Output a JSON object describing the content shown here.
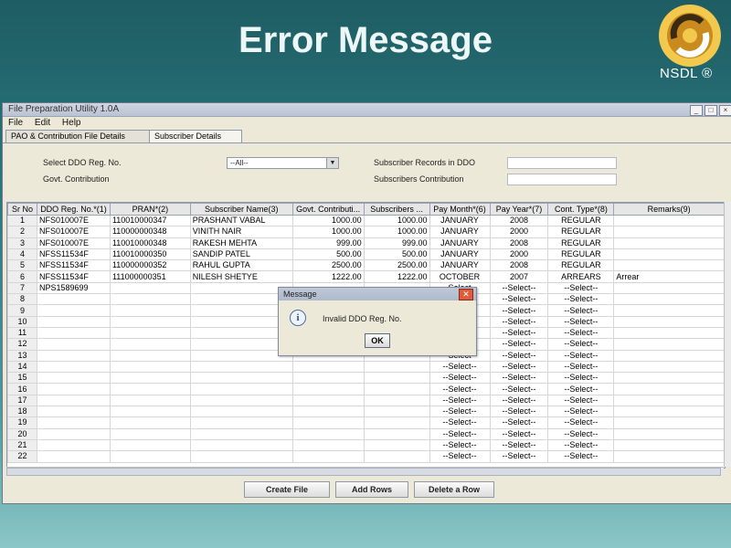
{
  "slide": {
    "title": "Error Message",
    "logo_text": "NSDL ®"
  },
  "window": {
    "title": "File Preparation Utility 1.0A",
    "menu": [
      "File",
      "Edit",
      "Help"
    ],
    "tabs": [
      "PAO & Contribution File Details",
      "Subscriber Details"
    ],
    "active_tab": 1
  },
  "form": {
    "ddo_label": "Select DDO Reg. No.",
    "ddo_value": "--All--",
    "govt_label": "Govt. Contribution",
    "records_label": "Subscriber Records in DDO",
    "contrib_label": "Subscribers Contribution"
  },
  "table": {
    "headers": [
      "Sr No",
      "DDO Reg. No.*(1)",
      "PRAN*(2)",
      "Subscriber Name(3)",
      "Govt. Contributi...",
      "Subscribers ...",
      "Pay Month*(6)",
      "Pay Year*(7)",
      "Cont. Type*(8)",
      "Remarks(9)"
    ],
    "rows": [
      [
        "1",
        "NFS010007E",
        "110010000347",
        "PRASHANT   VABAL",
        "1000.00",
        "1000.00",
        "JANUARY",
        "2008",
        "REGULAR",
        ""
      ],
      [
        "2",
        "NFS010007E",
        "110000000348",
        "VINITH   NAIR",
        "1000.00",
        "1000.00",
        "JANUARY",
        "2000",
        "REGULAR",
        ""
      ],
      [
        "3",
        "NFS010007E",
        "110010000348",
        "RAKESH   MEHTA",
        "999.00",
        "999.00",
        "JANUARY",
        "2008",
        "REGULAR",
        ""
      ],
      [
        "4",
        "NFSS11534F",
        "110010000350",
        "SANDIP   PATEL",
        "500.00",
        "500.00",
        "JANUARY",
        "2000",
        "REGULAR",
        ""
      ],
      [
        "5",
        "NFSS11534F",
        "110000000352",
        "RAHUL   GUPTA",
        "2500.00",
        "2500.00",
        "JANUARY",
        "2008",
        "REGULAR",
        ""
      ],
      [
        "6",
        "NFSS11534F",
        "111000000351",
        "NILESH   SHETYE",
        "1222.00",
        "1222.00",
        "OCTOBER",
        "2007",
        "ARREARS",
        "Arrear"
      ],
      [
        "7",
        "NPS1589699",
        "",
        "",
        "",
        "",
        "--Select--",
        "--Select--",
        "--Select--",
        ""
      ],
      [
        "8",
        "",
        "",
        "",
        "",
        "",
        "--Select--",
        "--Select--",
        "--Select--",
        ""
      ],
      [
        "9",
        "",
        "",
        "",
        "",
        "",
        "--Select--",
        "--Select--",
        "--Select--",
        ""
      ],
      [
        "10",
        "",
        "",
        "",
        "",
        "",
        "--Select--",
        "--Select--",
        "--Select--",
        ""
      ],
      [
        "11",
        "",
        "",
        "",
        "",
        "",
        "--Select--",
        "--Select--",
        "--Select--",
        ""
      ],
      [
        "12",
        "",
        "",
        "",
        "",
        "",
        "--Select--",
        "--Select--",
        "--Select--",
        ""
      ],
      [
        "13",
        "",
        "",
        "",
        "",
        "",
        "--Select--",
        "--Select--",
        "--Select--",
        ""
      ],
      [
        "14",
        "",
        "",
        "",
        "",
        "",
        "--Select--",
        "--Select--",
        "--Select--",
        ""
      ],
      [
        "15",
        "",
        "",
        "",
        "",
        "",
        "--Select--",
        "--Select--",
        "--Select--",
        ""
      ],
      [
        "16",
        "",
        "",
        "",
        "",
        "",
        "--Select--",
        "--Select--",
        "--Select--",
        ""
      ],
      [
        "17",
        "",
        "",
        "",
        "",
        "",
        "--Select--",
        "--Select--",
        "--Select--",
        ""
      ],
      [
        "18",
        "",
        "",
        "",
        "",
        "",
        "--Select--",
        "--Select--",
        "--Select--",
        ""
      ],
      [
        "19",
        "",
        "",
        "",
        "",
        "",
        "--Select--",
        "--Select--",
        "--Select--",
        ""
      ],
      [
        "20",
        "",
        "",
        "",
        "",
        "",
        "--Select--",
        "--Select--",
        "--Select--",
        ""
      ],
      [
        "21",
        "",
        "",
        "",
        "",
        "",
        "--Select--",
        "--Select--",
        "--Select--",
        ""
      ],
      [
        "22",
        "",
        "",
        "",
        "",
        "",
        "--Select--",
        "--Select--",
        "--Select--",
        ""
      ]
    ]
  },
  "buttons": {
    "create": "Create File",
    "add": "Add Rows",
    "delete": "Delete a Row"
  },
  "dialog": {
    "title": "Message",
    "message": "Invalid DDO Reg. No.",
    "ok": "OK"
  },
  "colors": {
    "slide_bg": "#2f7f86",
    "window_bg": "#ece9d8",
    "close_red": "#e05a3c"
  }
}
